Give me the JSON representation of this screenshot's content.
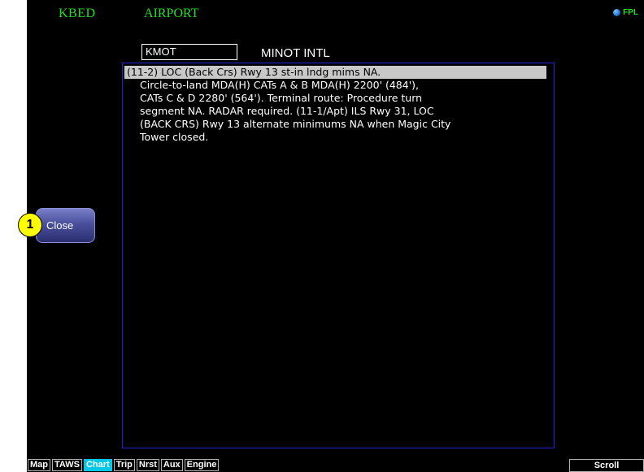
{
  "header": {
    "waypoint_id": "KBED",
    "page_mode": "AIRPORT",
    "fpl_label": "FPL",
    "globe_icon": "globe-icon"
  },
  "airport": {
    "identifier": "KMOT",
    "name": "MINOT INTL"
  },
  "notes": {
    "first_line": "(11-2) LOC (Back Crs) Rwy 13 st-in lndg mims NA.",
    "body": "Circle-to-land MDA(H) CATs A & B MDA(H) 2200' (484'),\nCATs C & D 2280' (564').  Terminal route: Procedure turn\nsegment NA.  RADAR required.  (11-1/Apt) ILS Rwy 31, LOC\n(BACK CRS) Rwy 13 alternate minimums NA when Magic City\nTower closed."
  },
  "buttons": {
    "close_label": "Close",
    "scroll_label": "Scroll"
  },
  "callout": {
    "number": "1"
  },
  "tabs": [
    {
      "label": "Map"
    },
    {
      "label": "TAWS"
    },
    {
      "label": "Chart",
      "active": true
    },
    {
      "label": "Trip"
    },
    {
      "label": "Nrst"
    },
    {
      "label": "Aux"
    },
    {
      "label": "Engine"
    }
  ],
  "colors": {
    "header_text": "#22dd22",
    "panel_border": "#2020d8",
    "active_tab": "#00c8e6",
    "callout": "#ffff00",
    "highlight": "#c8c8c8"
  }
}
